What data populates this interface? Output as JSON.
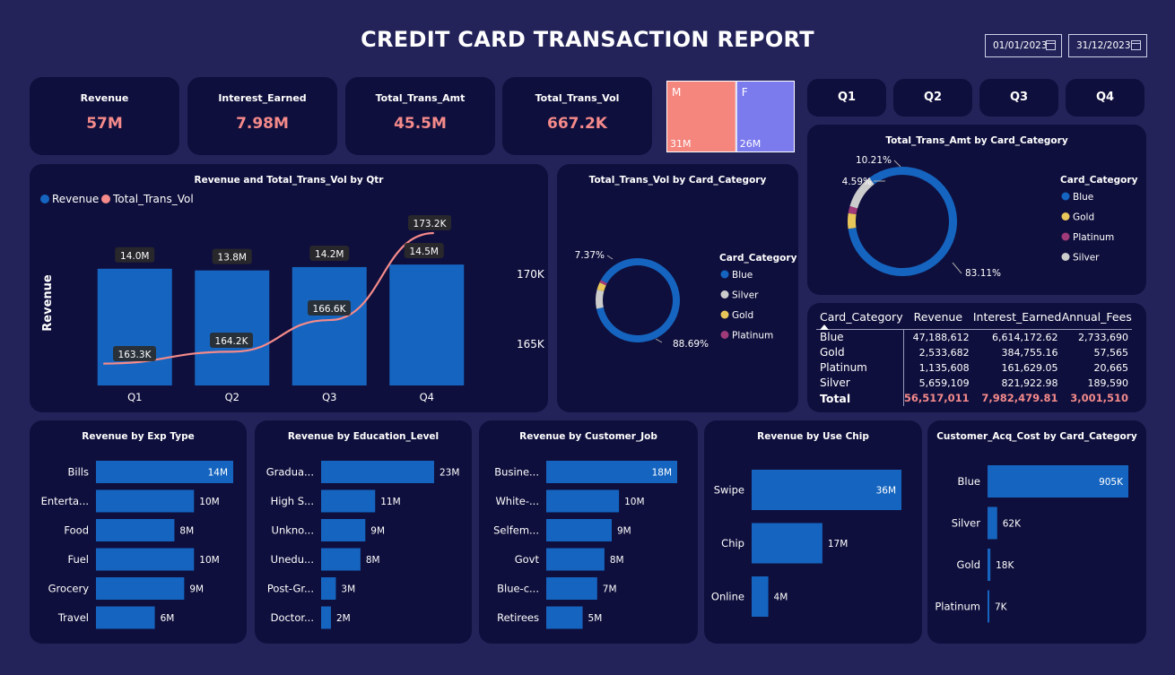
{
  "header": {
    "title": "CREDIT CARD TRANSACTION REPORT",
    "start_date": "01/01/2023",
    "end_date": "31/12/2023"
  },
  "kpis": [
    {
      "label": "Revenue",
      "value": "57M"
    },
    {
      "label": "Interest_Earned",
      "value": "7.98M"
    },
    {
      "label": "Total_Trans_Amt",
      "value": "45.5M"
    },
    {
      "label": "Total_Trans_Vol",
      "value": "667.2K"
    }
  ],
  "gender": {
    "items": [
      {
        "label": "M",
        "value": "31M",
        "amount": 31
      },
      {
        "label": "F",
        "value": "26M",
        "amount": 26
      }
    ]
  },
  "quarters": [
    "Q1",
    "Q2",
    "Q3",
    "Q4"
  ],
  "colors": {
    "background": "#23235a",
    "card": "#0f0f3d",
    "bar": "#1565c0",
    "accent": "#f48a8a",
    "male": "#f4867e",
    "female": "#7b7bee",
    "blue": "#1565c0",
    "gold": "#e8c65a",
    "platinum": "#a03a78",
    "silver": "#cccccc"
  },
  "chart_data": [
    {
      "id": "qtr",
      "type": "bar",
      "title": "Revenue and Total_Trans_Vol by Qtr",
      "ylabel": "Revenue",
      "categories": [
        "Q1",
        "Q2",
        "Q3",
        "Q4"
      ],
      "series": [
        {
          "name": "Revenue",
          "values": [
            14.0,
            13.8,
            14.2,
            14.5
          ],
          "labels": [
            "14.0M",
            "13.8M",
            "14.2M",
            "14.5M"
          ]
        },
        {
          "name": "Total_Trans_Vol",
          "type": "line",
          "values": [
            163.3,
            164.2,
            166.6,
            173.2
          ],
          "labels": [
            "163.3K",
            "164.2K",
            "166.6K",
            "173.2K"
          ]
        }
      ],
      "y2_ticks": [
        "170K",
        "165K"
      ],
      "legend": "top-left"
    },
    {
      "id": "vol_donut",
      "type": "pie",
      "title": "Total_Trans_Vol by Card_Category",
      "legend_title": "Card_Category",
      "categories": [
        "Blue",
        "Silver",
        "Gold",
        "Platinum"
      ],
      "values": [
        88.69,
        7.37,
        2.9,
        1.04
      ],
      "labels": [
        "88.69%",
        "7.37%",
        "",
        ""
      ],
      "legend": "right"
    },
    {
      "id": "amt_donut",
      "type": "pie",
      "title": "Total_Trans_Amt by Card_Category",
      "legend_title": "Card_Category",
      "categories": [
        "Blue",
        "Gold",
        "Platinum",
        "Silver"
      ],
      "values": [
        83.11,
        4.59,
        2.09,
        10.21
      ],
      "labels": [
        "83.11%",
        "4.59%",
        "",
        "10.21%"
      ],
      "legend": "right"
    },
    {
      "id": "table",
      "type": "table",
      "columns": [
        "Card_Category",
        "Revenue",
        "Interest_Earned",
        "Annual_Fees"
      ],
      "rows": [
        [
          "Blue",
          "47,188,612",
          "6,614,172.62",
          "2,733,690"
        ],
        [
          "Gold",
          "2,533,682",
          "384,755.16",
          "57,565"
        ],
        [
          "Platinum",
          "1,135,608",
          "161,629.05",
          "20,665"
        ],
        [
          "Silver",
          "5,659,109",
          "821,922.98",
          "189,590"
        ]
      ],
      "total": [
        "Total",
        "56,517,011",
        "7,982,479.81",
        "3,001,510"
      ]
    },
    {
      "id": "exp",
      "type": "bar",
      "orientation": "horizontal",
      "title": "Revenue by Exp Type",
      "categories": [
        "Bills",
        "Enterta...",
        "Food",
        "Fuel",
        "Grocery",
        "Travel"
      ],
      "values": [
        14,
        10,
        8,
        10,
        9,
        6
      ],
      "labels": [
        "14M",
        "10M",
        "8M",
        "10M",
        "9M",
        "6M"
      ]
    },
    {
      "id": "edu",
      "type": "bar",
      "orientation": "horizontal",
      "title": "Revenue by Education_Level",
      "categories": [
        "Gradua...",
        "High S...",
        "Unkno...",
        "Unedu...",
        "Post-Gr...",
        "Doctor..."
      ],
      "values": [
        23,
        11,
        9,
        8,
        3,
        2
      ],
      "labels": [
        "23M",
        "11M",
        "9M",
        "8M",
        "3M",
        "2M"
      ]
    },
    {
      "id": "job",
      "type": "bar",
      "orientation": "horizontal",
      "title": "Revenue by Customer_Job",
      "categories": [
        "Busine...",
        "White-...",
        "Selfem...",
        "Govt",
        "Blue-c...",
        "Retirees"
      ],
      "values": [
        18,
        10,
        9,
        8,
        7,
        5
      ],
      "labels": [
        "18M",
        "10M",
        "9M",
        "8M",
        "7M",
        "5M"
      ]
    },
    {
      "id": "chip",
      "type": "bar",
      "orientation": "horizontal",
      "title": "Revenue by Use Chip",
      "categories": [
        "Swipe",
        "Chip",
        "Online"
      ],
      "values": [
        36,
        17,
        4
      ],
      "labels": [
        "36M",
        "17M",
        "4M"
      ]
    },
    {
      "id": "acq",
      "type": "bar",
      "orientation": "horizontal",
      "title": "Customer_Acq_Cost by Card_Category",
      "categories": [
        "Blue",
        "Silver",
        "Gold",
        "Platinum"
      ],
      "values": [
        905,
        62,
        18,
        7
      ],
      "labels": [
        "905K",
        "62K",
        "18K",
        "7K"
      ]
    }
  ]
}
